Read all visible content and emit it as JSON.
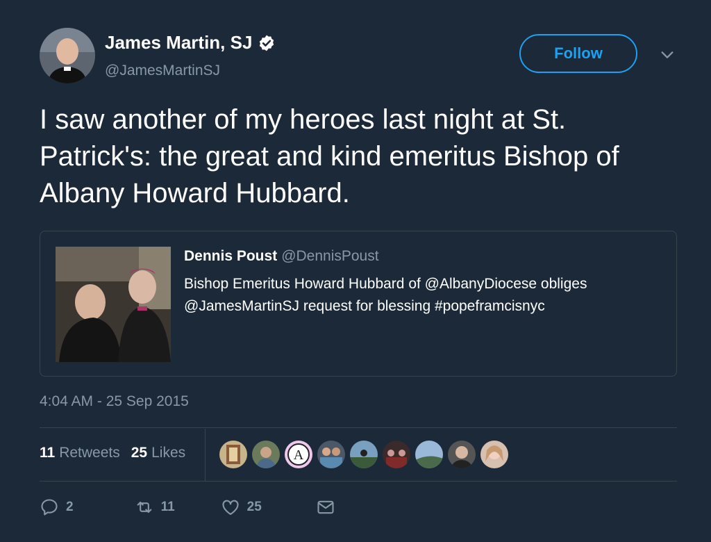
{
  "author": {
    "display_name": "James Martin, SJ",
    "handle": "@JamesMartinSJ",
    "verified": true
  },
  "follow_label": "Follow",
  "tweet_text": "I saw another of my heroes last night at St. Patrick's: the great and kind emeritus Bishop of Albany Howard Hubbard.",
  "quoted_tweet": {
    "display_name": "Dennis Poust",
    "handle": "@DennisPoust",
    "text": "Bishop Emeritus Howard Hubbard of @AlbanyDiocese obliges @JamesMartinSJ request for blessing #popeframcisnyc"
  },
  "timestamp": "4:04 AM - 25 Sep 2015",
  "stats": {
    "retweets_count": "11",
    "retweets_label": "Retweets",
    "likes_count": "25",
    "likes_label": "Likes"
  },
  "actions": {
    "reply_count": "2",
    "retweet_count": "11",
    "like_count": "25"
  },
  "colors": {
    "background": "#1c2938",
    "accent": "#1da1f2",
    "secondary_text": "#8899a6",
    "border": "#38444d"
  }
}
